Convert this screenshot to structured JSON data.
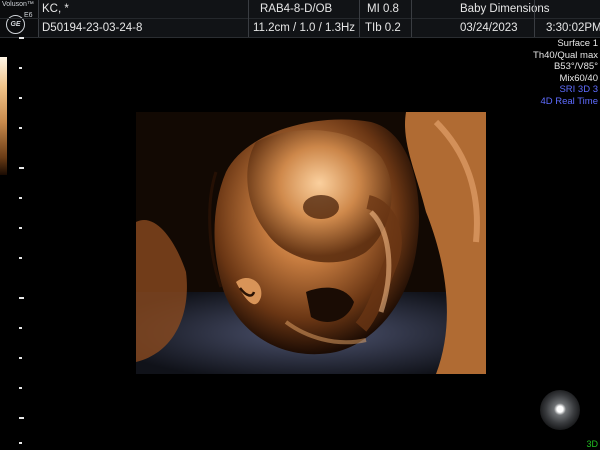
{
  "header": {
    "brand": "Voluson™",
    "model": "E6",
    "logo": "GE",
    "patient_name": "KC, *",
    "patient_id": "D50194-23-03-24-8",
    "probe": "RAB4-8-D/OB",
    "depth_info": "11.2cm / 1.0 / 1.3Hz",
    "mi": "MI  0.8",
    "tib": "TIb  0.2",
    "clinic": "Baby Dimensions",
    "date": "03/24/2023",
    "time": "3:30:02PM"
  },
  "params": {
    "line1": "Surface 1",
    "line2": "Th40/Qual max",
    "line3": "B53°/V85°",
    "line4": "Mix60/40",
    "line5": "SRI 3D 3",
    "line6": "4D Real Time"
  },
  "mode_label": "3D",
  "colors": {
    "highlight": "#5f6cff",
    "mode": "#22c022",
    "render_skin": "#c57b3f"
  },
  "icons": {
    "logo": "ge-logo-icon",
    "orientation": "orientation-sphere-icon"
  }
}
